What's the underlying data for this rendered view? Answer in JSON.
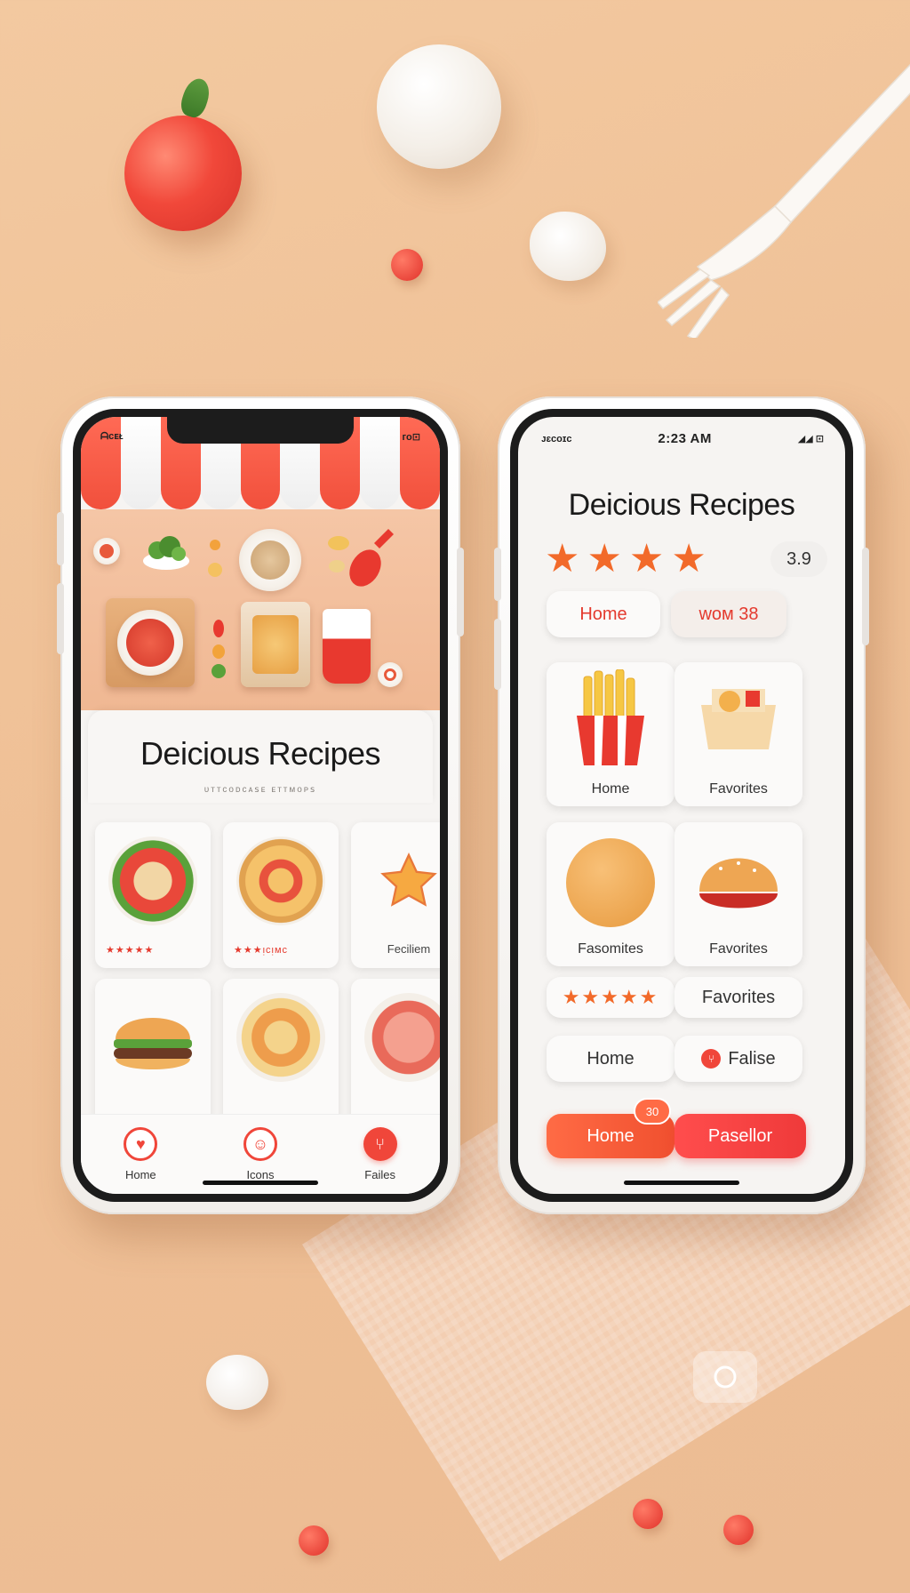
{
  "left_phone": {
    "status": {
      "carrier": "ᗩᴄᴇᴌ",
      "battery": "ᴦᴏ⊡"
    },
    "title": "Deicious Recipes",
    "subtitle": "ᴜᴛᴛᴄᴏᴅᴄᴀꜱᴇ ᴇᴛᴛᴍᴏᴘꜱ",
    "cards": [
      {
        "label": "★★★★★"
      },
      {
        "label": "★★★ᴉᴄᴉᴍᴄ"
      },
      {
        "label": "Feciliem"
      }
    ],
    "tabs": [
      {
        "label": "Home",
        "icon": "heart-icon"
      },
      {
        "label": "Icons",
        "icon": "face-icon"
      },
      {
        "label": "Failes",
        "icon": "fork-icon"
      }
    ]
  },
  "right_phone": {
    "status": {
      "carrier": "ᴊɛᴄᴏɪᴄ",
      "time": "2:23 AM",
      "battery": "◢◢ ⊡"
    },
    "title": "Deicious Recipes",
    "rating": {
      "stars": 4,
      "value": "3.9"
    },
    "top_pills": [
      {
        "label": "Home"
      },
      {
        "label": "ᴡᴏᴍ  38"
      }
    ],
    "tiles": [
      {
        "label": "Home",
        "icon": "fries-icon"
      },
      {
        "label": "Favorites",
        "icon": "gift-box-icon"
      },
      {
        "label": "Fasomites",
        "icon": "bun-icon"
      },
      {
        "label": "Favorites",
        "icon": "burger-icon"
      }
    ],
    "rating_pill_stars": "★★★★★",
    "mid_pills": [
      {
        "label": "Favorites"
      },
      {
        "label": "Home"
      },
      {
        "label": "Falise"
      }
    ],
    "bottom_pills": [
      {
        "label": "Home",
        "badge": "30"
      },
      {
        "label": "Pasellor"
      }
    ]
  },
  "colors": {
    "accent": "#f0463a",
    "orange": "#ff6b45",
    "background": "#efc096"
  }
}
